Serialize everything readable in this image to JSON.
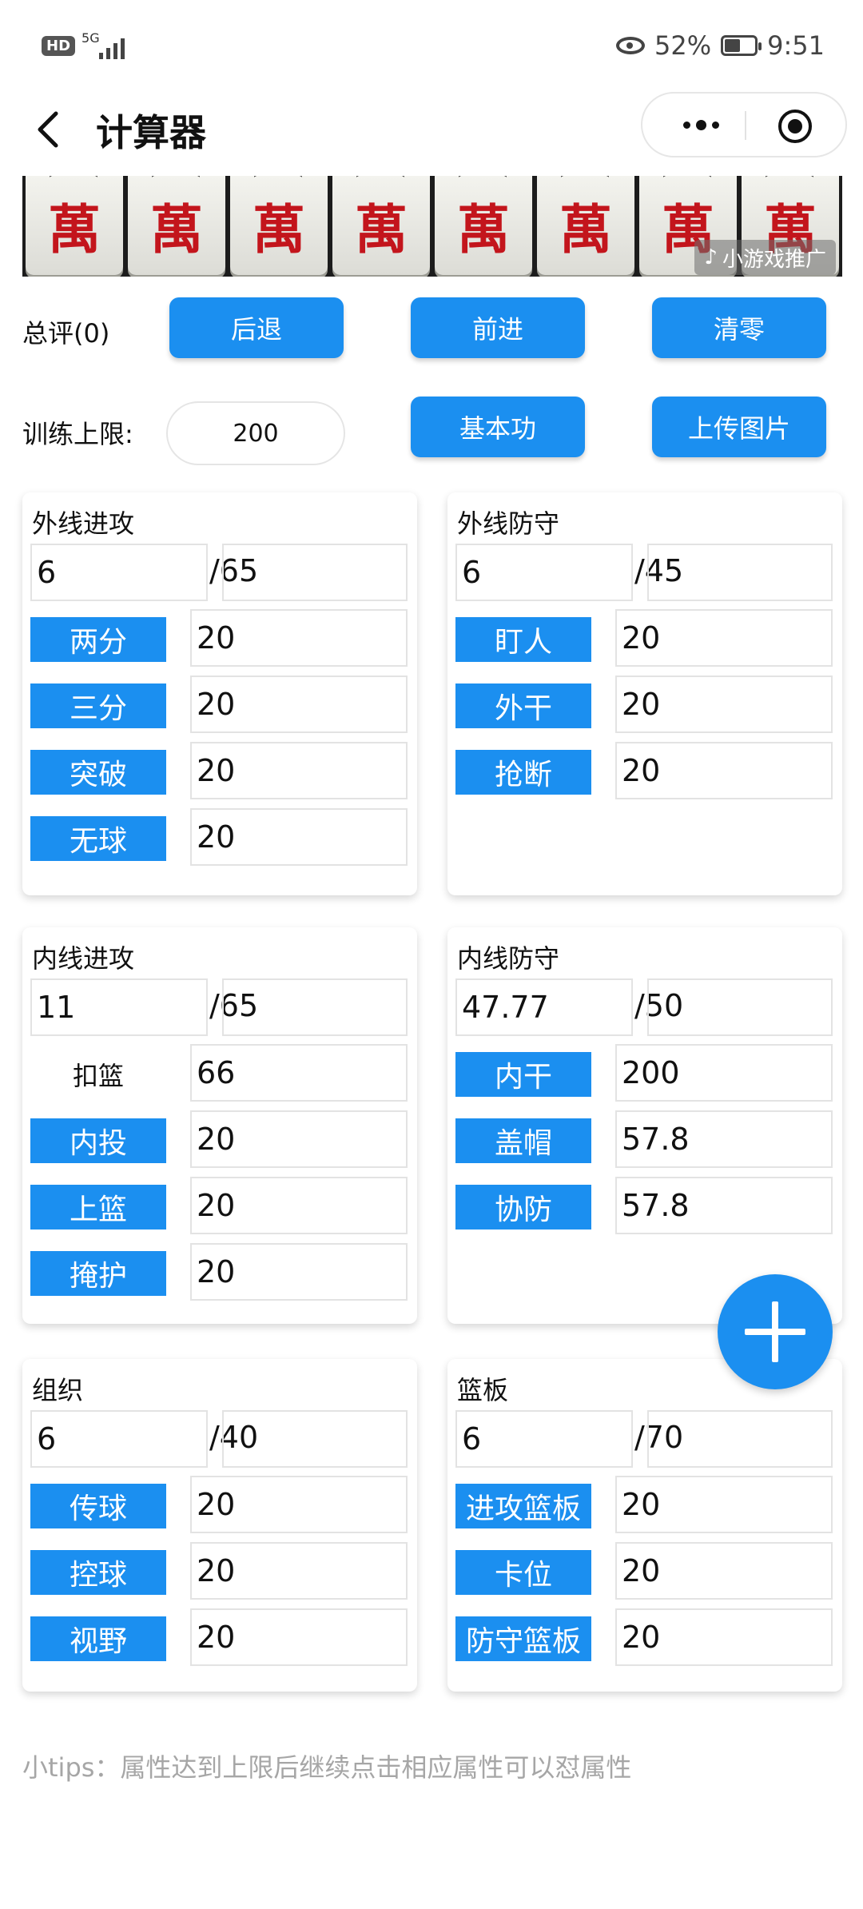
{
  "status": {
    "hd": "HD",
    "network": "5G",
    "battery": "52%",
    "battery_level": 0.52,
    "time": "9:51"
  },
  "nav": {
    "title": "计算器"
  },
  "banner": {
    "tile_char": "萬",
    "tile_count": 8,
    "ad_label": "小游戏推广"
  },
  "controls": {
    "total_label": "总评(0)",
    "back_btn": "后退",
    "forward_btn": "前进",
    "clear_btn": "清零",
    "limit_label": "训练上限:",
    "limit_value": "200",
    "basic_btn": "基本功",
    "upload_btn": "上传图片"
  },
  "cards": {
    "outside_attack": {
      "title": "外线进攻",
      "value": "6",
      "max": "/65",
      "attrs": [
        {
          "label": "两分",
          "value": "20"
        },
        {
          "label": "三分",
          "value": "20"
        },
        {
          "label": "突破",
          "value": "20"
        },
        {
          "label": "无球",
          "value": "20"
        }
      ]
    },
    "outside_defense": {
      "title": "外线防守",
      "value": "6",
      "max": "/45",
      "attrs": [
        {
          "label": "盯人",
          "value": "20"
        },
        {
          "label": "外干",
          "value": "20"
        },
        {
          "label": "抢断",
          "value": "20"
        }
      ]
    },
    "inside_attack": {
      "title": "内线进攻",
      "value": "11",
      "max": "/65",
      "attrs": [
        {
          "label": "扣篮",
          "value": "66"
        },
        {
          "label": "内投",
          "value": "20"
        },
        {
          "label": "上篮",
          "value": "20"
        },
        {
          "label": "掩护",
          "value": "20"
        }
      ]
    },
    "inside_defense": {
      "title": "内线防守",
      "value": "47.77",
      "max": "/50",
      "attrs": [
        {
          "label": "内干",
          "value": "200"
        },
        {
          "label": "盖帽",
          "value": "57.8"
        },
        {
          "label": "协防",
          "value": "57.8"
        }
      ]
    },
    "organize": {
      "title": "组织",
      "value": "6",
      "max": "/40",
      "attrs": [
        {
          "label": "传球",
          "value": "20"
        },
        {
          "label": "控球",
          "value": "20"
        },
        {
          "label": "视野",
          "value": "20"
        }
      ]
    },
    "rebound": {
      "title": "篮板",
      "value": "6",
      "max": "/70",
      "attrs": [
        {
          "label": "进攻篮板",
          "value": "20"
        },
        {
          "label": "卡位",
          "value": "20"
        },
        {
          "label": "防守篮板",
          "value": "20"
        }
      ]
    }
  },
  "tips": "小tips：属性达到上限后继续点击相应属性可以怼属性",
  "colors": {
    "accent": "#1b8ff0",
    "tile_red": "#c3151c"
  }
}
